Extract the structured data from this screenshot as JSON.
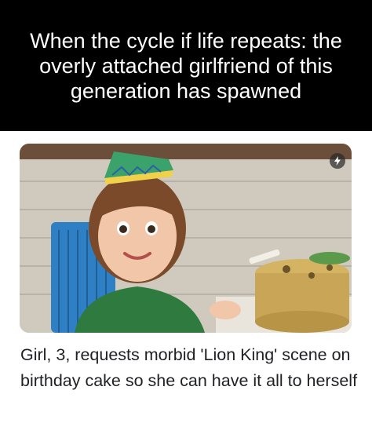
{
  "caption": {
    "text": "When the cycle if life repeats: the overly attached girlfriend of this generation has spawned"
  },
  "article": {
    "headline": "Girl, 3, requests morbid 'Lion King' scene on birthday cake so she can have it all to herself",
    "badge_icon": "lightning-bolt-icon",
    "image": "photo of a young girl in a party hat next to a Lion King birthday cake"
  },
  "colors": {
    "caption_background": "#000000",
    "caption_text": "#ffffff",
    "headline_text": "#202124"
  }
}
